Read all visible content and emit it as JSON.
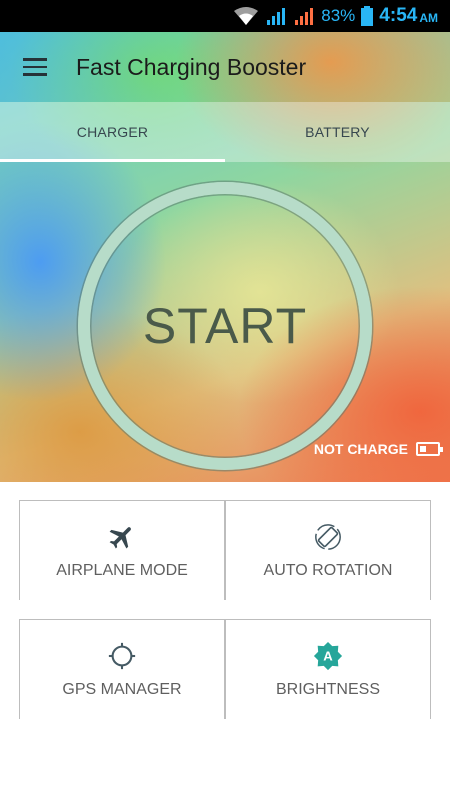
{
  "status_bar": {
    "battery_percent": "83%",
    "time": "4:54",
    "ampm": "AM",
    "accent_color": "#29b6f6",
    "icons": [
      "wifi-icon",
      "signal-icon",
      "signal-icon",
      "battery-icon"
    ]
  },
  "app_bar": {
    "title": "Fast Charging Booster",
    "menu_icon": "hamburger-menu-icon"
  },
  "tabs": [
    {
      "label": "CHARGER",
      "active": true
    },
    {
      "label": "BATTERY",
      "active": false
    }
  ],
  "main": {
    "start_label": "START",
    "charge_status": "NOT CHARGE",
    "charge_icon": "battery-low-icon"
  },
  "tools": [
    {
      "label": "AIRPLANE MODE",
      "icon": "airplane-icon"
    },
    {
      "label": "AUTO ROTATION",
      "icon": "screen-rotation-icon"
    },
    {
      "label": "GPS MANAGER",
      "icon": "gps-crosshair-icon"
    },
    {
      "label": "BRIGHTNESS",
      "icon": "brightness-auto-icon",
      "accent": "#26a69a"
    }
  ]
}
